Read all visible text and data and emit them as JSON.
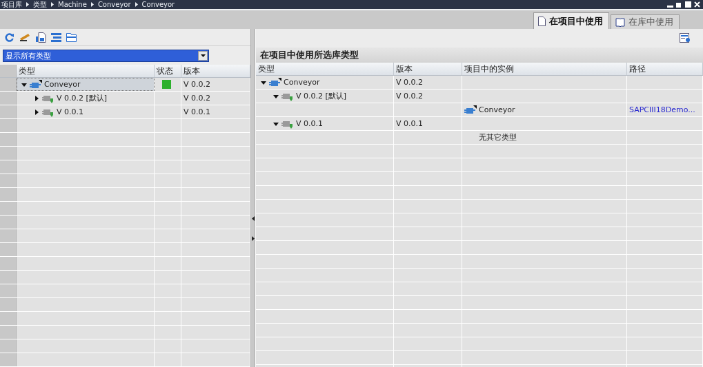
{
  "breadcrumb": [
    "项目库",
    "类型",
    "Machine",
    "Conveyor",
    "Conveyor"
  ],
  "tabs": [
    {
      "label": "在项目中使用",
      "selected": true
    },
    {
      "label": "在库中使用",
      "selected": false
    }
  ],
  "left": {
    "filter": {
      "value": "显示所有类型"
    },
    "columns": [
      "类型",
      "状态",
      "版本"
    ],
    "rows": [
      {
        "type": "Conveyor",
        "status_ok": true,
        "version": "V 0.0.2",
        "expanded": true,
        "selected": true,
        "children": [
          {
            "type": "V 0.0.2 [默认]",
            "status_ok": false,
            "version": "V 0.0.2",
            "expanded": false,
            "selected": false
          },
          {
            "type": "V 0.0.1",
            "status_ok": false,
            "version": "V 0.0.1",
            "expanded": false,
            "selected": false
          }
        ]
      }
    ]
  },
  "right": {
    "title": "在项目中使用所选库类型",
    "columns": [
      "类型",
      "版本",
      "项目中的实例",
      "路径"
    ],
    "rows": [
      {
        "kind": "type",
        "type": "Conveyor",
        "version": "V 0.0.2",
        "expanded": true,
        "children": [
          {
            "kind": "version",
            "type": "V 0.0.2 [默认]",
            "version": "V 0.0.2",
            "expanded": true,
            "children": [
              {
                "kind": "instance",
                "instance": "Conveyor",
                "path": "SAPCIII18Demo..."
              }
            ]
          },
          {
            "kind": "version",
            "type": "V 0.0.1",
            "version": "V 0.0.1",
            "expanded": true,
            "children": [
              {
                "kind": "note",
                "instance": "无其它类型"
              }
            ]
          }
        ]
      }
    ]
  }
}
